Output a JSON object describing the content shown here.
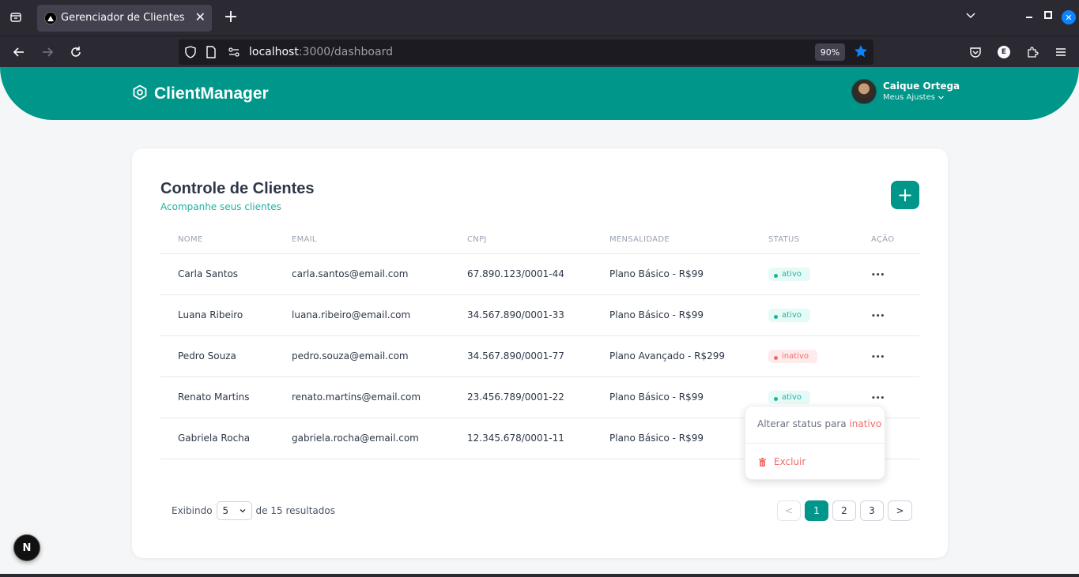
{
  "browser": {
    "tab_title": "Gerenciador de Clientes",
    "tab_close": "✕",
    "new_tab": "+",
    "url_host": "localhost",
    "url_rest": ":3000/dashboard",
    "zoom": "90%",
    "ext_e": "E"
  },
  "header": {
    "brand": "ClientManager",
    "user_name": "Caique Ortega",
    "user_settings": "Meus Ajustes"
  },
  "card": {
    "title": "Controle de Clientes",
    "subtitle": "Acompanhe seus clientes",
    "add_label": "+"
  },
  "table": {
    "headers": [
      "NOME",
      "EMAIL",
      "CNPJ",
      "MENSALIDADE",
      "STATUS",
      "AÇÃO"
    ],
    "rows": [
      {
        "name": "Carla Santos",
        "email": "carla.santos@email.com",
        "cnpj": "67.890.123/0001-44",
        "plan": "Plano Básico - R$99",
        "status": "ativo"
      },
      {
        "name": "Luana Ribeiro",
        "email": "luana.ribeiro@email.com",
        "cnpj": "34.567.890/0001-33",
        "plan": "Plano Básico - R$99",
        "status": "ativo"
      },
      {
        "name": "Pedro Souza",
        "email": "pedro.souza@email.com",
        "cnpj": "34.567.890/0001-77",
        "plan": "Plano Avançado - R$299",
        "status": "inativo"
      },
      {
        "name": "Renato Martins",
        "email": "renato.martins@email.com",
        "cnpj": "23.456.789/0001-22",
        "plan": "Plano Básico - R$99",
        "status": "ativo"
      },
      {
        "name": "Gabriela Rocha",
        "email": "gabriela.rocha@email.com",
        "cnpj": "12.345.678/0001-11",
        "plan": "Plano Básico - R$99",
        "status": ""
      }
    ],
    "action_glyph": "•••"
  },
  "dropdown": {
    "change_status_prefix": "Alterar status para ",
    "change_status_value": "inativo",
    "delete_label": "Excluir"
  },
  "footer": {
    "showing_label": "Exibindo",
    "page_size": "5",
    "results_label": "de 15 resultados",
    "prev": "<",
    "pages": [
      "1",
      "2",
      "3"
    ],
    "next": ">"
  },
  "next_badge": "N",
  "colors": {
    "accent": "#00968a",
    "active": "#1eb39f",
    "inactive": "#f06b6b"
  }
}
